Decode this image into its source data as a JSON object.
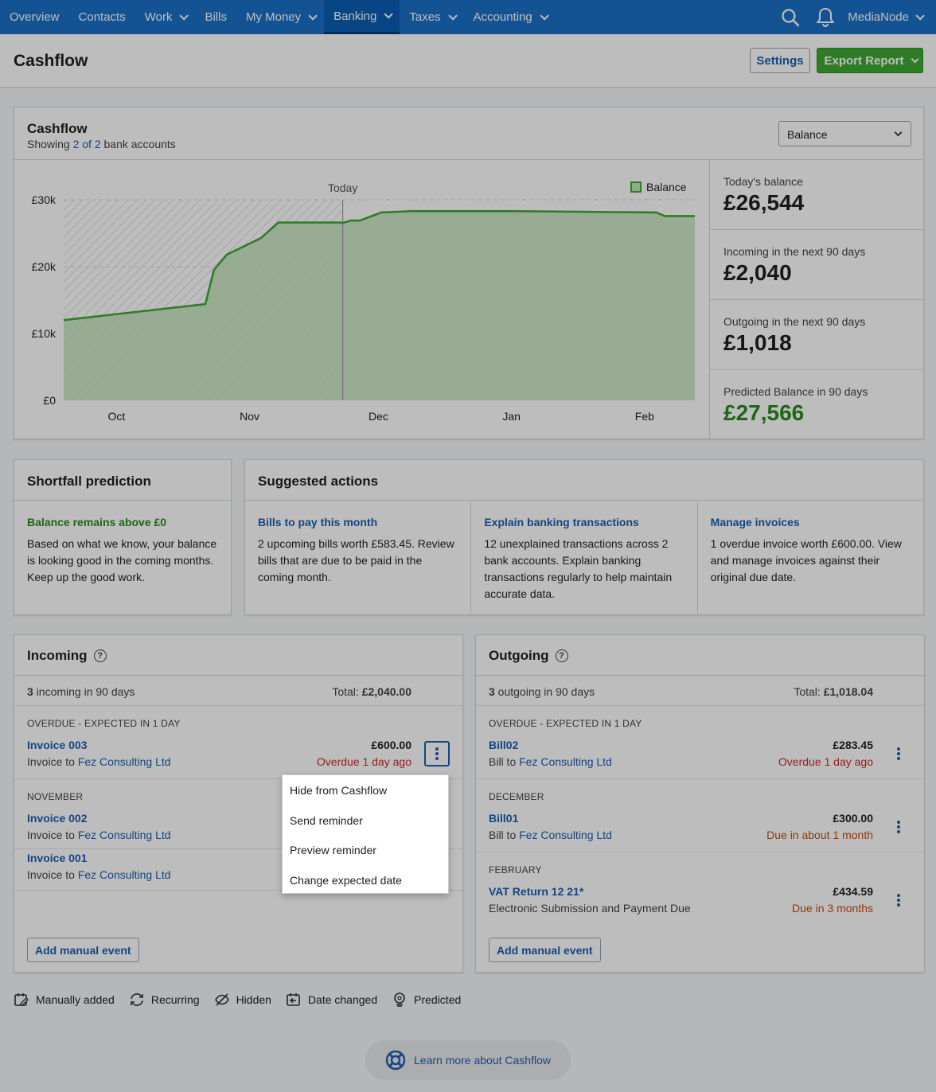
{
  "nav": {
    "items": [
      {
        "label": "Overview",
        "dropdown": false
      },
      {
        "label": "Contacts",
        "dropdown": false
      },
      {
        "label": "Work",
        "dropdown": true
      },
      {
        "label": "Bills",
        "dropdown": false
      },
      {
        "label": "My Money",
        "dropdown": true
      },
      {
        "label": "Banking",
        "dropdown": true,
        "active": true
      },
      {
        "label": "Taxes",
        "dropdown": true
      },
      {
        "label": "Accounting",
        "dropdown": true
      }
    ],
    "org": "MediaNode",
    "icons": [
      "search-icon",
      "bell-icon",
      "chevron-down-icon"
    ]
  },
  "header": {
    "title": "Cashflow",
    "settings_label": "Settings",
    "export_label": "Export Report"
  },
  "cashflow": {
    "title": "Cashflow",
    "sub_prefix": "Showing ",
    "sub_link": "2 of 2",
    "sub_suffix": " bank accounts",
    "select_value": "Balance"
  },
  "stats": {
    "todays_label": "Today's balance",
    "todays_value": "£26,544",
    "incoming_label": "Incoming in the next 90 days",
    "incoming_value": "£2,040",
    "outgoing_label": "Outgoing in the next 90 days",
    "outgoing_value": "£1,018",
    "predicted_label": "Predicted Balance in 90 days",
    "predicted_value": "£27,566"
  },
  "chart_data": {
    "type": "area",
    "title": "",
    "xlabel": "",
    "ylabel": "",
    "x_ticks": [
      "Oct",
      "Nov",
      "Dec",
      "Jan",
      "Feb"
    ],
    "y_ticks": [
      "£0",
      "£10k",
      "£20k",
      "£30k"
    ],
    "ylim": [
      0,
      30000
    ],
    "today_label": "Today",
    "legend": "Balance",
    "legend_position": "top-right",
    "grid": true,
    "color": "#3fa934",
    "series": [
      {
        "name": "Balance",
        "x": [
          "2023-09-20",
          "2023-10-23",
          "2023-10-25",
          "2023-10-28",
          "2023-11-05",
          "2023-11-09",
          "2023-11-23",
          "2023-11-24",
          "2023-11-26",
          "2023-11-28",
          "2023-12-03",
          "2023-12-10",
          "2024-01-03",
          "2024-02-05",
          "2024-02-07",
          "2024-02-14"
        ],
        "values": [
          12000,
          14400,
          19500,
          21800,
          24300,
          26600,
          26600,
          26544,
          26900,
          26900,
          28100,
          28300,
          28300,
          28100,
          27566,
          27566
        ]
      }
    ]
  },
  "shortfall": {
    "title": "Shortfall prediction",
    "heading": "Balance remains above £0",
    "text": "Based on what we know, your balance is looking good in the coming months. Keep up the good work."
  },
  "suggested": {
    "title": "Suggested actions",
    "actions": [
      {
        "title": "Bills to pay this month",
        "text": "2 upcoming bills worth £583.45. Review bills that are due to be paid in the coming month."
      },
      {
        "title": "Explain banking transactions",
        "text": "12 unexplained transactions across 2 bank accounts. Explain banking transactions regularly to help maintain accurate data."
      },
      {
        "title": "Manage invoices",
        "text": "1 overdue invoice worth £600.00. View and manage invoices against their original due date."
      }
    ]
  },
  "incoming": {
    "title": "Incoming",
    "count_num": "3",
    "count_text": " incoming in 90 days",
    "total_label": "Total: ",
    "total_value": "£2,040.00",
    "group1": "OVERDUE - EXPECTED IN 1 DAY",
    "group2": "NOVEMBER",
    "events": [
      {
        "title": "Invoice 003",
        "prefix": "Invoice to ",
        "contact": "Fez Consulting Ltd",
        "amount": "£600.00",
        "status": "Overdue 1 day ago"
      },
      {
        "title": "Invoice 002",
        "prefix": "Invoice to ",
        "contact": "Fez Consulting Ltd"
      },
      {
        "title": "Invoice 001",
        "prefix": "Invoice to ",
        "contact": "Fez Consulting Ltd"
      }
    ],
    "add_label": "Add manual event"
  },
  "outgoing": {
    "title": "Outgoing",
    "count_num": "3",
    "count_text": " outgoing in 90 days",
    "total_label": "Total: ",
    "total_value": "£1,018.04",
    "group1": "OVERDUE - EXPECTED IN 1 DAY",
    "group2": "DECEMBER",
    "group3": "FEBRUARY",
    "events": [
      {
        "title": "Bill02",
        "prefix": "Bill to ",
        "contact": "Fez Consulting Ltd",
        "amount": "£283.45",
        "status": "Overdue 1 day ago"
      },
      {
        "title": "Bill01",
        "prefix": "Bill to ",
        "contact": "Fez Consulting Ltd",
        "amount": "£300.00",
        "status": "Due in about 1 month"
      },
      {
        "title": "VAT Return 12 21*",
        "sub": "Electronic Submission and Payment Due",
        "amount": "£434.59",
        "status": "Due in 3 months"
      }
    ],
    "add_label": "Add manual event"
  },
  "menu": {
    "items": [
      "Hide from Cashflow",
      "Send reminder",
      "Preview reminder",
      "Change expected date"
    ],
    "highlighted": "Preview reminder"
  },
  "legend": {
    "items": [
      {
        "icon": "calendar-edit-icon",
        "label": "Manually added"
      },
      {
        "icon": "recurring-icon",
        "label": "Recurring"
      },
      {
        "icon": "hidden-icon",
        "label": "Hidden"
      },
      {
        "icon": "date-changed-icon",
        "label": "Date changed"
      },
      {
        "icon": "predicted-icon",
        "label": "Predicted"
      }
    ]
  },
  "learn_more": "Learn more about Cashflow"
}
